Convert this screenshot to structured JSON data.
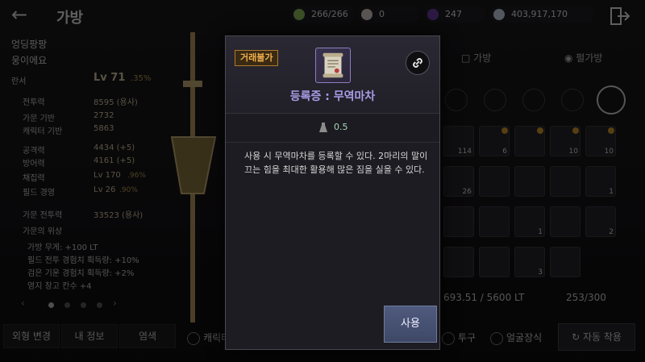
{
  "header": {
    "title": "가방",
    "currencies": [
      {
        "icon": "contribution-icon",
        "value": "266/266",
        "color": "#8fbf5a"
      },
      {
        "icon": "pearl-icon",
        "value": "0",
        "color": "#d8d0c8"
      },
      {
        "icon": "black-gem-icon",
        "value": "247",
        "color": "#6b3fa8"
      },
      {
        "icon": "silver-icon",
        "value": "403,917,170",
        "color": "#c9d6e6"
      }
    ]
  },
  "character": {
    "family_name": "엉딩팡팡",
    "char_name": "웅이에요",
    "class": "란서",
    "level": "Lv 71",
    "level_pct": ".35%",
    "combat_power_label": "전투력",
    "combat_power_value": "8595 (용사)",
    "family_base_label": "가문 기반",
    "family_base_value": "2732",
    "char_base_label": "캐릭터 기반",
    "char_base_value": "5863",
    "attack_label": "공격력",
    "attack_value": "4434 (+5)",
    "defense_label": "방어력",
    "defense_value": "4161 (+5)",
    "gathering_label": "채집력",
    "gathering_value": "Lv 170",
    "gathering_pct": ".96%",
    "field_label": "필드 경영",
    "field_value": "Lv 26",
    "field_pct": ".90%",
    "family_combat_label": "가문 전투력",
    "family_combat_value": "33523 (용사)",
    "family_standing_label": "가문의 위상",
    "bonus_1": "가방 무게: +100 LT",
    "bonus_2": "필드 전투 경험치 획득량: +10%",
    "bonus_3": "검은 기운 경험치 획득량: +2%",
    "bonus_4": "영지 창고 칸수 +4"
  },
  "bottom_buttons": {
    "appearance": "외형 변경",
    "my_info": "내 정보",
    "dye": "염색",
    "char_check": "캐릭터",
    "helmet": "투구",
    "face_deco": "얼굴장식",
    "auto_equip": "자동 착용"
  },
  "inventory": {
    "tab_bag": "가방",
    "tab_pearl_bag": "펄가방",
    "weight": "693.51 / 5600 LT",
    "slots": "253/300",
    "slot_counts": [
      "114",
      "6",
      "",
      "10",
      "10",
      "26",
      "",
      "",
      "",
      "1",
      "",
      "",
      "1",
      "",
      "2",
      "",
      "",
      "3",
      "",
      ""
    ]
  },
  "modal": {
    "untradable_tag": "거래불가",
    "item_name": "등록증 : 무역마차",
    "weight": "0.5",
    "description": "사용 시 무역마차를 등록할 수 있다. 2마리의 말이 끄는 힘을 최대한 활용해 많은 짐을 실을 수 있다.",
    "use_button": "사용"
  }
}
